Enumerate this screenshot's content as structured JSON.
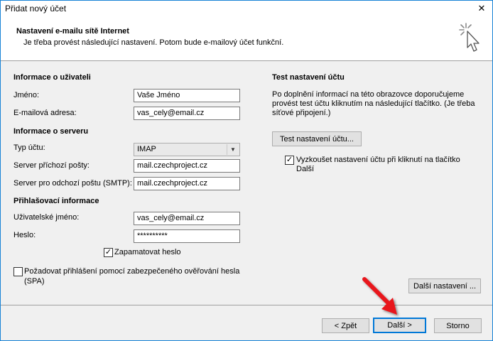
{
  "window": {
    "title": "Přidat nový účet",
    "close_glyph": "✕"
  },
  "header": {
    "title": "Nastavení e-mailu sítě Internet",
    "subtitle": "Je třeba provést následující nastavení. Potom bude e-mailový účet funkční.",
    "icon": "cursor-sparkle-icon"
  },
  "user_info": {
    "heading": "Informace o uživateli",
    "name_label": "Jméno:",
    "name_value": "Vaše Jméno",
    "email_label": "E-mailová adresa:",
    "email_value": "vas_cely@email.cz"
  },
  "server_info": {
    "heading": "Informace o serveru",
    "account_type_label": "Typ účtu:",
    "account_type_value": "IMAP",
    "incoming_label": "Server příchozí pošty:",
    "incoming_value": "mail.czechproject.cz",
    "outgoing_label": "Server pro odchozí poštu (SMTP):",
    "outgoing_value": "mail.czechproject.cz"
  },
  "login_info": {
    "heading": "Přihlašovací informace",
    "username_label": "Uživatelské jméno:",
    "username_value": "vas_cely@email.cz",
    "password_label": "Heslo:",
    "password_value": "**********",
    "remember_label": "Zapamatovat heslo",
    "remember_checked": true,
    "spa_label_line1": "Požadovat přihlášení pomocí zabezpečeného ověřování hesla",
    "spa_label_line2": "(SPA)",
    "spa_checked": false
  },
  "test_settings": {
    "heading": "Test nastavení účtu",
    "description_line1": "Po doplnění informací na této obrazovce doporučujeme",
    "description_line2": "provést test účtu kliknutím na následující tlačítko. (Je třeba",
    "description_line3": "síťové připojení.)",
    "test_button": "Test nastavení účtu...",
    "auto_test_line1": "Vyzkoušet nastavení účtu při kliknutí na tlačítko",
    "auto_test_line2": "Další",
    "auto_test_checked": true
  },
  "more_settings_button": "Další nastavení ...",
  "footer": {
    "back": "< Zpět",
    "next": "Další >",
    "cancel": "Storno"
  },
  "check_glyph": "✓",
  "dropdown_glyph": "▼",
  "colors": {
    "accent": "#0078d7",
    "annotation_arrow": "#e8171e"
  }
}
